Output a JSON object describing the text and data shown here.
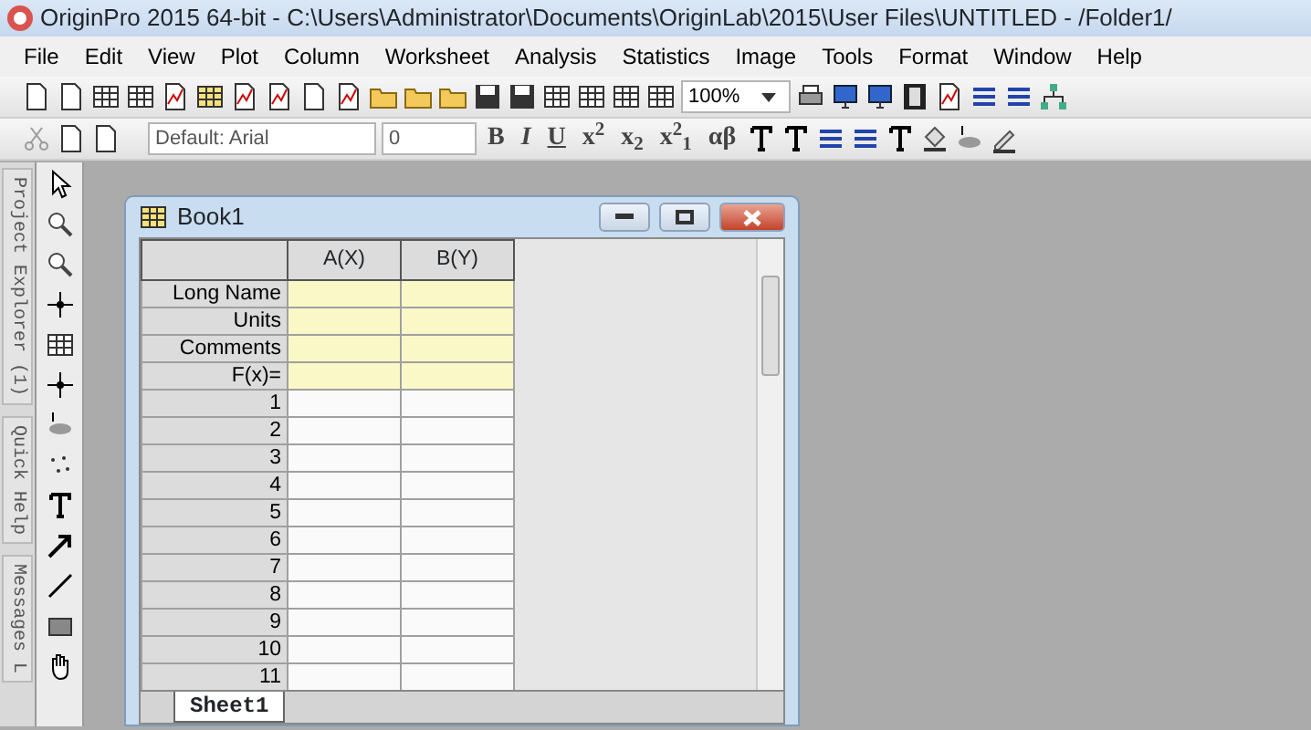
{
  "window": {
    "title": "OriginPro 2015 64-bit - C:\\Users\\Administrator\\Documents\\OriginLab\\2015\\User Files\\UNTITLED - /Folder1/"
  },
  "menu": [
    "File",
    "Edit",
    "View",
    "Plot",
    "Column",
    "Worksheet",
    "Analysis",
    "Statistics",
    "Image",
    "Tools",
    "Format",
    "Window",
    "Help"
  ],
  "standard_toolbar": {
    "zoom": "100%"
  },
  "format_toolbar": {
    "font": "Default: Arial",
    "size": "0",
    "buttons": [
      "B",
      "I",
      "U",
      "x$^{2}$",
      "x$_{2}$",
      "x$^{2}$$_{1}$",
      "αβ"
    ]
  },
  "dock_tabs": [
    "Project Explorer (1)",
    "Quick Help",
    "Messages L"
  ],
  "book": {
    "title": "Book1",
    "columns": [
      "A(X)",
      "B(Y)"
    ],
    "label_rows": [
      "Long Name",
      "Units",
      "Comments",
      "F(x)="
    ],
    "rows": [
      "1",
      "2",
      "3",
      "4",
      "5",
      "6",
      "7",
      "8",
      "9",
      "10",
      "11"
    ],
    "sheet_tabs": [
      {
        "label": "Sheet1",
        "selected": true
      }
    ]
  }
}
